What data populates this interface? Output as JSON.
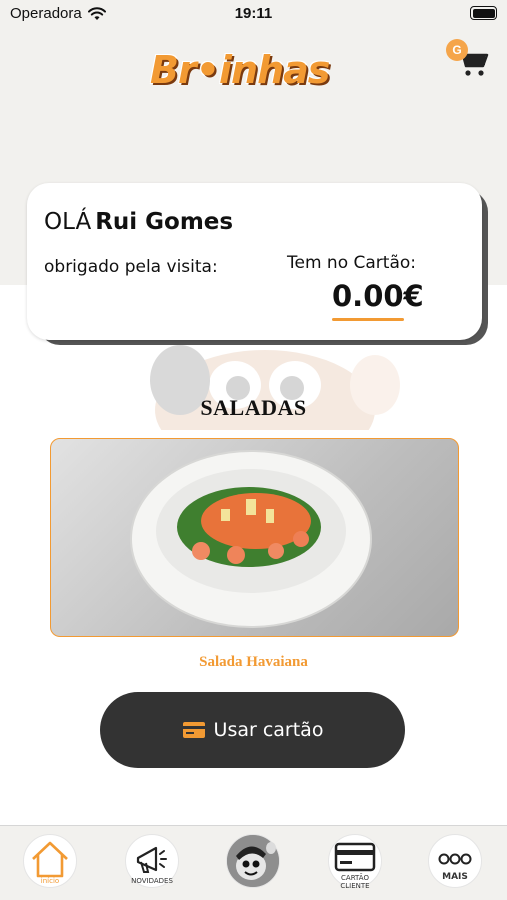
{
  "status_bar": {
    "carrier": "Operadora",
    "time": "19:11"
  },
  "header": {
    "logo_text": "Br•inhas",
    "cart_badge": "G"
  },
  "greeting": {
    "hello": "OLÁ",
    "user_name": "Rui Gomes",
    "thanks": "obrigado pela visita:",
    "balance_label": "Tem no Cartão:",
    "balance_value": "0.00€"
  },
  "section": {
    "title": "SALADAS"
  },
  "product": {
    "name": "Salada Havaiana"
  },
  "actions": {
    "use_card": "Usar cartão"
  },
  "tabbar": {
    "items": [
      {
        "label": "início"
      },
      {
        "label": "NOVIDADES"
      },
      {
        "label": ""
      },
      {
        "label": "CARTÃO\nCLIENTE"
      },
      {
        "label": "MAIS"
      }
    ]
  },
  "colors": {
    "accent": "#f29a33",
    "dark_button": "#333333",
    "background": "#f2f1ee"
  }
}
